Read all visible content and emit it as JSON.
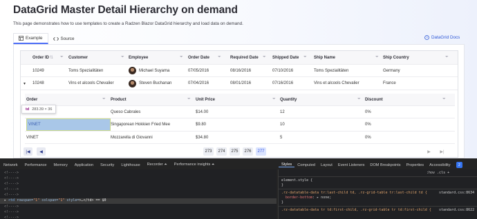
{
  "page": {
    "title": "DataGrid Master Detail Hierarchy on demand",
    "description": "This page demonstrates how to use templates to create a Radzen Blazor DataGrid hierarchy and load data on demand.",
    "docs_link": "DataGrid Docs"
  },
  "tabs": [
    {
      "label": "Example",
      "icon": "grid-icon",
      "active": true
    },
    {
      "label": "Source",
      "icon": "code-icon",
      "active": false
    }
  ],
  "grid": {
    "columns": [
      "Order ID",
      "Customer",
      "Employee",
      "Order Date",
      "Required Date",
      "Shipped Date",
      "Ship Name",
      "Ship Country"
    ],
    "rows": [
      {
        "order_id": "10249",
        "customer": "Toms Spezialitäten",
        "employee": "Michael Suyama",
        "order_date": "07/05/2016",
        "required_date": "08/16/2016",
        "shipped_date": "07/10/2016",
        "ship_name": "Toms Spezialitäten",
        "ship_country": "Germany",
        "expand": ""
      },
      {
        "order_id": "10248",
        "customer": "Vins et alcools Chevalier",
        "employee": "Steven Buchanan",
        "order_date": "07/04/2016",
        "required_date": "08/01/2016",
        "shipped_date": "07/16/2016",
        "ship_name": "Vins et alcools Chevalier",
        "ship_country": "France",
        "expand": "▾"
      }
    ],
    "detail": {
      "columns": [
        "Order",
        "Product",
        "Unit Price",
        "Quantity",
        "Discount"
      ],
      "rows": [
        {
          "order": "VINET",
          "product": "Queso Cabrales",
          "unit_price": "$14.00",
          "quantity": "12",
          "discount": "0%"
        },
        {
          "order": "VINET",
          "product": "Singaporean Hokkien Fried Mee",
          "unit_price": "$9.80",
          "quantity": "10",
          "discount": "0%"
        },
        {
          "order": "VINET",
          "product": "Mozzarella di Giovanni",
          "unit_price": "$34.80",
          "quantity": "5",
          "discount": "0%"
        }
      ]
    },
    "tooltip": {
      "tag": "td",
      "dims": "283.39 × 36"
    }
  },
  "pager": {
    "first": "|◀",
    "prev": "◀",
    "next": "▶",
    "last": "▶|",
    "pages": [
      "273",
      "274",
      "275",
      "276",
      "277"
    ],
    "current": "277"
  },
  "devtools": {
    "tabs": [
      "Network",
      "Performance",
      "Memory",
      "Application",
      "Security",
      "Lighthouse",
      "Recorder ⏶",
      "Performance insights ⏶"
    ],
    "side_tabs": [
      "Styles",
      "Computed",
      "Layout",
      "Event Listeners",
      "DOM Breakpoints",
      "Properties",
      "Accessibility"
    ],
    "badge": "2",
    "filter_hint": ":hov  .cls  +",
    "code_lines": [
      "<!---->",
      "<!---->",
      "<!---->",
      "<!---->",
      "<!---->"
    ],
    "selected_line": {
      "prefix": "▸",
      "tag": "<td",
      "attr1": "rowspan=",
      "val1": "\"1\"",
      "attr2": "colspan=",
      "val2": "\"1\"",
      "attr3": "style=",
      "rest": ">…</td> == $0"
    },
    "code_lines_after": [
      "<!---->",
      "<!---->",
      "<!---->"
    ],
    "styles": {
      "element_style": "element.style {",
      "close": "}",
      "rule1_selector": ".rz-datatable-data tr:last-child td, .rz-grid-table tr:last-child td {",
      "rule1_prop": "border-bottom",
      "rule1_value": ": ▸ none;",
      "rule1_source": "standard.css:8634",
      "rule2_selector": ".rz-datatable-data tr td:first-child, .rz-grid-table tr td:first-child {",
      "rule2_source": "standard.css:8622"
    }
  }
}
